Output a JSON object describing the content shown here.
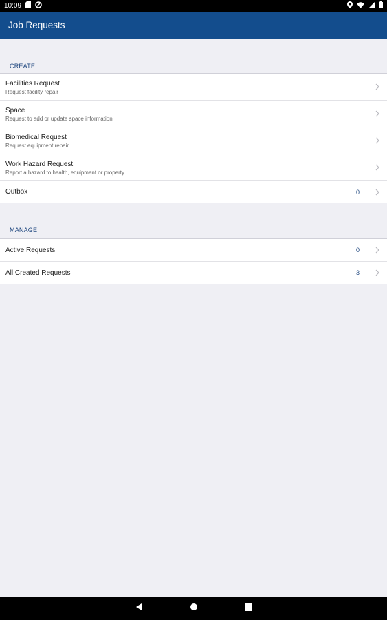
{
  "status_bar": {
    "time": "10:09"
  },
  "app_bar": {
    "title": "Job Requests"
  },
  "sections": {
    "create": {
      "header": "CREATE",
      "items": [
        {
          "title": "Facilities Request",
          "subtitle": "Request facility repair"
        },
        {
          "title": "Space",
          "subtitle": "Request to add or update space information"
        },
        {
          "title": "Biomedical Request",
          "subtitle": "Request equipment repair"
        },
        {
          "title": "Work Hazard Request",
          "subtitle": "Report a hazard to health, equipment or property"
        },
        {
          "title": "Outbox",
          "count": "0"
        }
      ]
    },
    "manage": {
      "header": "MANAGE",
      "items": [
        {
          "title": "Active Requests",
          "count": "0"
        },
        {
          "title": "All Created Requests",
          "count": "3"
        }
      ]
    }
  },
  "colors": {
    "app_bar": "#134d8d",
    "accent_text": "#1e467e",
    "background": "#efeff4"
  }
}
